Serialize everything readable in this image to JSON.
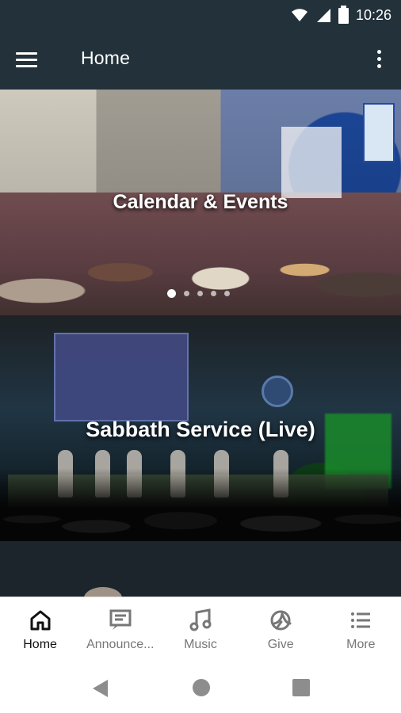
{
  "status_bar": {
    "time": "10:26",
    "icons": [
      "wifi-icon",
      "signal-icon",
      "battery-icon"
    ]
  },
  "app_bar": {
    "title": "Home",
    "icons": [
      "menu-icon",
      "overflow-menu-icon"
    ]
  },
  "carousel": {
    "title": "Calendar & Events",
    "page_count": 5,
    "active_page": 1
  },
  "service_card": {
    "title": "Sabbath Service (Live)"
  },
  "bottom_nav": {
    "items": [
      {
        "label": "Home",
        "icon": "home-icon",
        "active": true
      },
      {
        "label": "Announce...",
        "icon": "announcement-icon",
        "active": false
      },
      {
        "label": "Music",
        "icon": "music-note-icon",
        "active": false
      },
      {
        "label": "Give",
        "icon": "give-icon",
        "active": false
      },
      {
        "label": "More",
        "icon": "list-icon",
        "active": false
      }
    ]
  },
  "colors": {
    "app_bar": "#22313a",
    "active_nav": "#111111",
    "inactive_nav": "#777777"
  }
}
